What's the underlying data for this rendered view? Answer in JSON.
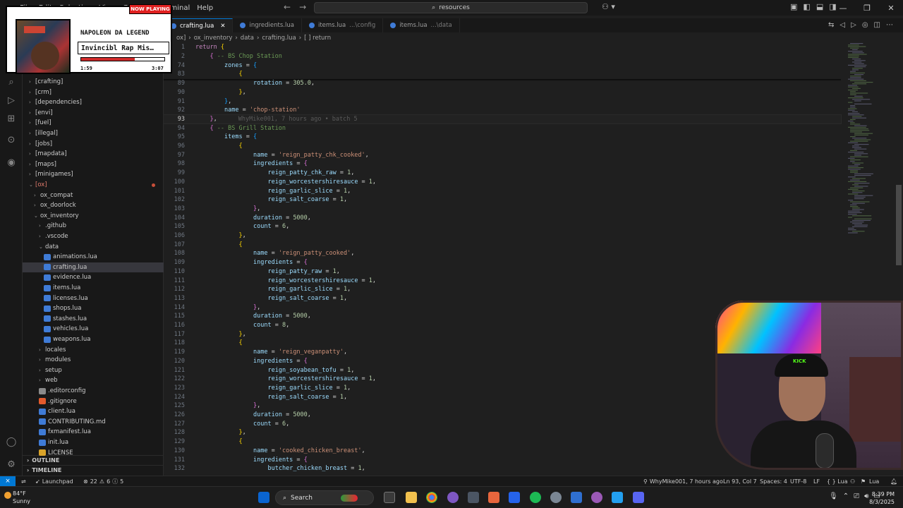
{
  "titlebar": {
    "menu": [
      "File",
      "Edit",
      "Selection",
      "View",
      "Go",
      "Run",
      "Terminal",
      "Help"
    ],
    "search_text": "resources"
  },
  "tabs": [
    {
      "label": "crafting.lua",
      "desc": "",
      "active": true
    },
    {
      "label": "ingredients.lua",
      "desc": "",
      "active": false
    },
    {
      "label": "items.lua",
      "desc": "...\\config",
      "active": false
    },
    {
      "label": "items.lua",
      "desc": "...\\data",
      "active": false
    }
  ],
  "breadcrumb": [
    "ox]",
    "ox_inventory",
    "data",
    "crafting.lua",
    "[ ] return"
  ],
  "explorer": {
    "items": [
      {
        "label": "[crafting]",
        "type": "folder",
        "depth": 1,
        "open": false
      },
      {
        "label": "[crm]",
        "type": "folder",
        "depth": 1,
        "open": false
      },
      {
        "label": "[dependencies]",
        "type": "folder",
        "depth": 1,
        "open": false
      },
      {
        "label": "[envi]",
        "type": "folder",
        "depth": 1,
        "open": false
      },
      {
        "label": "[fuel]",
        "type": "folder",
        "depth": 1,
        "open": false
      },
      {
        "label": "[illegal]",
        "type": "folder",
        "depth": 1,
        "open": false
      },
      {
        "label": "[jobs]",
        "type": "folder",
        "depth": 1,
        "open": false
      },
      {
        "label": "[mapdata]",
        "type": "folder",
        "depth": 1,
        "open": false
      },
      {
        "label": "[maps]",
        "type": "folder",
        "depth": 1,
        "open": false
      },
      {
        "label": "[minigames]",
        "type": "folder",
        "depth": 1,
        "open": false
      },
      {
        "label": "[ox]",
        "type": "folder",
        "depth": 1,
        "open": true,
        "modified": true
      },
      {
        "label": "ox_compat",
        "type": "folder",
        "depth": 2,
        "open": false
      },
      {
        "label": "ox_doorlock",
        "type": "folder",
        "depth": 2,
        "open": false
      },
      {
        "label": "ox_inventory",
        "type": "folder",
        "depth": 2,
        "open": true
      },
      {
        "label": ".github",
        "type": "folder",
        "depth": 3,
        "open": false
      },
      {
        "label": ".vscode",
        "type": "folder",
        "depth": 3,
        "open": false
      },
      {
        "label": "data",
        "type": "folder",
        "depth": 3,
        "open": true
      },
      {
        "label": "animations.lua",
        "type": "lua",
        "depth": 4
      },
      {
        "label": "crafting.lua",
        "type": "lua",
        "depth": 4,
        "selected": true
      },
      {
        "label": "evidence.lua",
        "type": "lua",
        "depth": 4
      },
      {
        "label": "items.lua",
        "type": "lua",
        "depth": 4
      },
      {
        "label": "licenses.lua",
        "type": "lua",
        "depth": 4
      },
      {
        "label": "shops.lua",
        "type": "lua",
        "depth": 4
      },
      {
        "label": "stashes.lua",
        "type": "lua",
        "depth": 4
      },
      {
        "label": "vehicles.lua",
        "type": "lua",
        "depth": 4
      },
      {
        "label": "weapons.lua",
        "type": "lua",
        "depth": 4
      },
      {
        "label": "locales",
        "type": "folder",
        "depth": 3,
        "open": false
      },
      {
        "label": "modules",
        "type": "folder",
        "depth": 3,
        "open": false
      },
      {
        "label": "setup",
        "type": "folder",
        "depth": 3,
        "open": false
      },
      {
        "label": "web",
        "type": "folder",
        "depth": 3,
        "open": false
      },
      {
        "label": ".editorconfig",
        "type": "config",
        "depth": 3
      },
      {
        "label": ".gitignore",
        "type": "git",
        "depth": 3
      },
      {
        "label": "client.lua",
        "type": "lua",
        "depth": 3
      },
      {
        "label": "CONTRIBUTING.md",
        "type": "md",
        "depth": 3
      },
      {
        "label": "fxmanifest.lua",
        "type": "lua",
        "depth": 3
      },
      {
        "label": "init.lua",
        "type": "lua",
        "depth": 3
      },
      {
        "label": "LICENSE",
        "type": "license",
        "depth": 3
      }
    ],
    "outline_label": "OUTLINE",
    "timeline_label": "TIMELINE"
  },
  "code": {
    "lines": [
      {
        "n": "1",
        "indent": 0,
        "parts": [
          [
            "k",
            "return"
          ],
          [
            "o",
            " "
          ],
          [
            "b",
            "{"
          ]
        ]
      },
      {
        "n": "2",
        "indent": 1,
        "parts": [
          [
            "b2",
            "{"
          ],
          [
            "o",
            " "
          ],
          [
            "c",
            "-- BS Chop Station"
          ]
        ]
      },
      {
        "n": "74",
        "indent": 2,
        "parts": [
          [
            "p",
            "zones"
          ],
          [
            "o",
            " = "
          ],
          [
            "b3",
            "{"
          ]
        ]
      },
      {
        "n": "83",
        "indent": 3,
        "parts": [
          [
            "b",
            "{"
          ]
        ]
      },
      {
        "n": "89",
        "indent": 4,
        "parts": [
          [
            "p",
            "rotation"
          ],
          [
            "o",
            " = "
          ],
          [
            "n",
            "305.0"
          ],
          [
            "o",
            ","
          ]
        ]
      },
      {
        "n": "90",
        "indent": 3,
        "parts": [
          [
            "b",
            "}"
          ],
          [
            "o",
            ","
          ]
        ]
      },
      {
        "n": "91",
        "indent": 2,
        "parts": [
          [
            "b3",
            "}"
          ],
          [
            "o",
            ","
          ]
        ]
      },
      {
        "n": "92",
        "indent": 2,
        "parts": [
          [
            "p",
            "name"
          ],
          [
            "o",
            " = "
          ],
          [
            "s",
            "'chop-station'"
          ]
        ]
      },
      {
        "n": "93",
        "indent": 1,
        "parts": [
          [
            "b2",
            "}"
          ],
          [
            "o",
            ","
          ]
        ],
        "current": true,
        "blame": "WhyMike001, 7 hours ago • batch 5"
      },
      {
        "n": "94",
        "indent": 1,
        "parts": [
          [
            "b2",
            "{"
          ],
          [
            "o",
            " "
          ],
          [
            "c",
            "-- BS Grill Station"
          ]
        ]
      },
      {
        "n": "95",
        "indent": 2,
        "parts": [
          [
            "p",
            "items"
          ],
          [
            "o",
            " = "
          ],
          [
            "b3",
            "{"
          ]
        ]
      },
      {
        "n": "96",
        "indent": 3,
        "parts": [
          [
            "b",
            "{"
          ]
        ]
      },
      {
        "n": "97",
        "indent": 4,
        "parts": [
          [
            "p",
            "name"
          ],
          [
            "o",
            " = "
          ],
          [
            "s",
            "'reign_patty_chk_cooked'"
          ],
          [
            "o",
            ","
          ]
        ]
      },
      {
        "n": "98",
        "indent": 4,
        "parts": [
          [
            "p",
            "ingredients"
          ],
          [
            "o",
            " = "
          ],
          [
            "b2",
            "{"
          ]
        ]
      },
      {
        "n": "99",
        "indent": 5,
        "parts": [
          [
            "p",
            "reign_patty_chk_raw"
          ],
          [
            "o",
            " = "
          ],
          [
            "n",
            "1"
          ],
          [
            "o",
            ","
          ]
        ]
      },
      {
        "n": "100",
        "indent": 5,
        "parts": [
          [
            "p",
            "reign_worcestershiresauce"
          ],
          [
            "o",
            " = "
          ],
          [
            "n",
            "1"
          ],
          [
            "o",
            ","
          ]
        ]
      },
      {
        "n": "101",
        "indent": 5,
        "parts": [
          [
            "p",
            "reign_garlic_slice"
          ],
          [
            "o",
            " = "
          ],
          [
            "n",
            "1"
          ],
          [
            "o",
            ","
          ]
        ]
      },
      {
        "n": "102",
        "indent": 5,
        "parts": [
          [
            "p",
            "reign_salt_coarse"
          ],
          [
            "o",
            " = "
          ],
          [
            "n",
            "1"
          ],
          [
            "o",
            ","
          ]
        ]
      },
      {
        "n": "103",
        "indent": 4,
        "parts": [
          [
            "b2",
            "}"
          ],
          [
            "o",
            ","
          ]
        ]
      },
      {
        "n": "104",
        "indent": 4,
        "parts": [
          [
            "p",
            "duration"
          ],
          [
            "o",
            " = "
          ],
          [
            "n",
            "5000"
          ],
          [
            "o",
            ","
          ]
        ]
      },
      {
        "n": "105",
        "indent": 4,
        "parts": [
          [
            "p",
            "count"
          ],
          [
            "o",
            " = "
          ],
          [
            "n",
            "6"
          ],
          [
            "o",
            ","
          ]
        ]
      },
      {
        "n": "106",
        "indent": 3,
        "parts": [
          [
            "b",
            "}"
          ],
          [
            "o",
            ","
          ]
        ]
      },
      {
        "n": "107",
        "indent": 3,
        "parts": [
          [
            "b",
            "{"
          ]
        ]
      },
      {
        "n": "108",
        "indent": 4,
        "parts": [
          [
            "p",
            "name"
          ],
          [
            "o",
            " = "
          ],
          [
            "s",
            "'reign_patty_cooked'"
          ],
          [
            "o",
            ","
          ]
        ]
      },
      {
        "n": "109",
        "indent": 4,
        "parts": [
          [
            "p",
            "ingredients"
          ],
          [
            "o",
            " = "
          ],
          [
            "b2",
            "{"
          ]
        ]
      },
      {
        "n": "110",
        "indent": 5,
        "parts": [
          [
            "p",
            "reign_patty_raw"
          ],
          [
            "o",
            " = "
          ],
          [
            "n",
            "1"
          ],
          [
            "o",
            ","
          ]
        ]
      },
      {
        "n": "111",
        "indent": 5,
        "parts": [
          [
            "p",
            "reign_worcestershiresauce"
          ],
          [
            "o",
            " = "
          ],
          [
            "n",
            "1"
          ],
          [
            "o",
            ","
          ]
        ]
      },
      {
        "n": "112",
        "indent": 5,
        "parts": [
          [
            "p",
            "reign_garlic_slice"
          ],
          [
            "o",
            " = "
          ],
          [
            "n",
            "1"
          ],
          [
            "o",
            ","
          ]
        ]
      },
      {
        "n": "113",
        "indent": 5,
        "parts": [
          [
            "p",
            "reign_salt_coarse"
          ],
          [
            "o",
            " = "
          ],
          [
            "n",
            "1"
          ],
          [
            "o",
            ","
          ]
        ]
      },
      {
        "n": "114",
        "indent": 4,
        "parts": [
          [
            "b2",
            "}"
          ],
          [
            "o",
            ","
          ]
        ]
      },
      {
        "n": "115",
        "indent": 4,
        "parts": [
          [
            "p",
            "duration"
          ],
          [
            "o",
            " = "
          ],
          [
            "n",
            "5000"
          ],
          [
            "o",
            ","
          ]
        ]
      },
      {
        "n": "116",
        "indent": 4,
        "parts": [
          [
            "p",
            "count"
          ],
          [
            "o",
            " = "
          ],
          [
            "n",
            "8"
          ],
          [
            "o",
            ","
          ]
        ]
      },
      {
        "n": "117",
        "indent": 3,
        "parts": [
          [
            "b",
            "}"
          ],
          [
            "o",
            ","
          ]
        ]
      },
      {
        "n": "118",
        "indent": 3,
        "parts": [
          [
            "b",
            "{"
          ]
        ]
      },
      {
        "n": "119",
        "indent": 4,
        "parts": [
          [
            "p",
            "name"
          ],
          [
            "o",
            " = "
          ],
          [
            "s",
            "'reign_veganpatty'"
          ],
          [
            "o",
            ","
          ]
        ]
      },
      {
        "n": "120",
        "indent": 4,
        "parts": [
          [
            "p",
            "ingredients"
          ],
          [
            "o",
            " = "
          ],
          [
            "b2",
            "{"
          ]
        ]
      },
      {
        "n": "121",
        "indent": 5,
        "parts": [
          [
            "p",
            "reign_soyabean_tofu"
          ],
          [
            "o",
            " = "
          ],
          [
            "n",
            "1"
          ],
          [
            "o",
            ","
          ]
        ]
      },
      {
        "n": "122",
        "indent": 5,
        "parts": [
          [
            "p",
            "reign_worcestershiresauce"
          ],
          [
            "o",
            " = "
          ],
          [
            "n",
            "1"
          ],
          [
            "o",
            ","
          ]
        ]
      },
      {
        "n": "123",
        "indent": 5,
        "parts": [
          [
            "p",
            "reign_garlic_slice"
          ],
          [
            "o",
            " = "
          ],
          [
            "n",
            "1"
          ],
          [
            "o",
            ","
          ]
        ]
      },
      {
        "n": "124",
        "indent": 5,
        "parts": [
          [
            "p",
            "reign_salt_coarse"
          ],
          [
            "o",
            " = "
          ],
          [
            "n",
            "1"
          ],
          [
            "o",
            ","
          ]
        ]
      },
      {
        "n": "125",
        "indent": 4,
        "parts": [
          [
            "b2",
            "}"
          ],
          [
            "o",
            ","
          ]
        ]
      },
      {
        "n": "126",
        "indent": 4,
        "parts": [
          [
            "p",
            "duration"
          ],
          [
            "o",
            " = "
          ],
          [
            "n",
            "5000"
          ],
          [
            "o",
            ","
          ]
        ]
      },
      {
        "n": "127",
        "indent": 4,
        "parts": [
          [
            "p",
            "count"
          ],
          [
            "o",
            " = "
          ],
          [
            "n",
            "6"
          ],
          [
            "o",
            ","
          ]
        ]
      },
      {
        "n": "128",
        "indent": 3,
        "parts": [
          [
            "b",
            "}"
          ],
          [
            "o",
            ","
          ]
        ]
      },
      {
        "n": "129",
        "indent": 3,
        "parts": [
          [
            "b",
            "{"
          ]
        ]
      },
      {
        "n": "130",
        "indent": 4,
        "parts": [
          [
            "p",
            "name"
          ],
          [
            "o",
            " = "
          ],
          [
            "s",
            "'cooked_chicken_breast'"
          ],
          [
            "o",
            ","
          ]
        ]
      },
      {
        "n": "131",
        "indent": 4,
        "parts": [
          [
            "p",
            "ingredients"
          ],
          [
            "o",
            " = "
          ],
          [
            "b2",
            "{"
          ]
        ]
      },
      {
        "n": "132",
        "indent": 5,
        "parts": [
          [
            "p",
            "butcher_chicken_breast"
          ],
          [
            "o",
            " = "
          ],
          [
            "n",
            "1"
          ],
          [
            "o",
            ","
          ]
        ]
      }
    ]
  },
  "statusbar": {
    "launchpad": "Launchpad",
    "errors": "22",
    "warnings": "6",
    "infos": "5",
    "blame": "WhyMike001, 7 hours ago",
    "position": "Ln 93, Col 7",
    "spaces": "Spaces: 4",
    "encoding": "UTF-8",
    "eol": "LF",
    "language_braces": "{ } Lua",
    "language": "Lua"
  },
  "taskbar": {
    "temperature": "84°F",
    "condition": "Sunny",
    "search_label": "Search",
    "time": "8:39 PM",
    "date": "8/3/2025",
    "notification_count": "9"
  },
  "now_playing": {
    "badge": "NOW PLAYING",
    "artist": "NAPOLEON DA LEGEND",
    "title": "Invincibl Rap Mis…",
    "elapsed": "1:59",
    "total": "3:07",
    "progress": 0.64
  },
  "webcam": {
    "cap_text": "KICK"
  }
}
